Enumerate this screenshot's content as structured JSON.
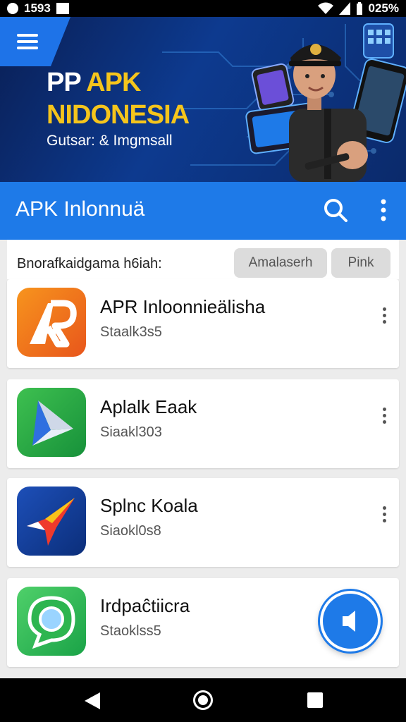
{
  "status_bar": {
    "left_text": "1593",
    "right_text": "025%"
  },
  "banner": {
    "title_line1_a": "PP",
    "title_line1_b": "APK",
    "title_line2": "NIDONESIA",
    "tagline": "Gutsar: & Imgmsall"
  },
  "app_bar": {
    "title": "APK Inlonnuä"
  },
  "filter": {
    "label": "Bnorafkaidgama h6iah:",
    "chips": [
      "Amalaserh",
      "Pink"
    ]
  },
  "apps": [
    {
      "name": "APR Inloonnieälisha",
      "sub": "Staalk3s5",
      "icon": "apr-app-icon"
    },
    {
      "name": "Aplalk Eaak",
      "sub": "Siaakl303",
      "icon": "play-arrow-app-icon"
    },
    {
      "name": "Splnc Koala",
      "sub": "Siaokl0s8",
      "icon": "rocket-app-icon"
    },
    {
      "name": "Irdpaĉtiicra",
      "sub": "Staoklss5",
      "icon": "chat-bubble-app-icon"
    }
  ],
  "colors": {
    "accent": "#1e7ae8",
    "banner_gold": "#f5c51c",
    "banner_dark": "#0a1f55"
  }
}
